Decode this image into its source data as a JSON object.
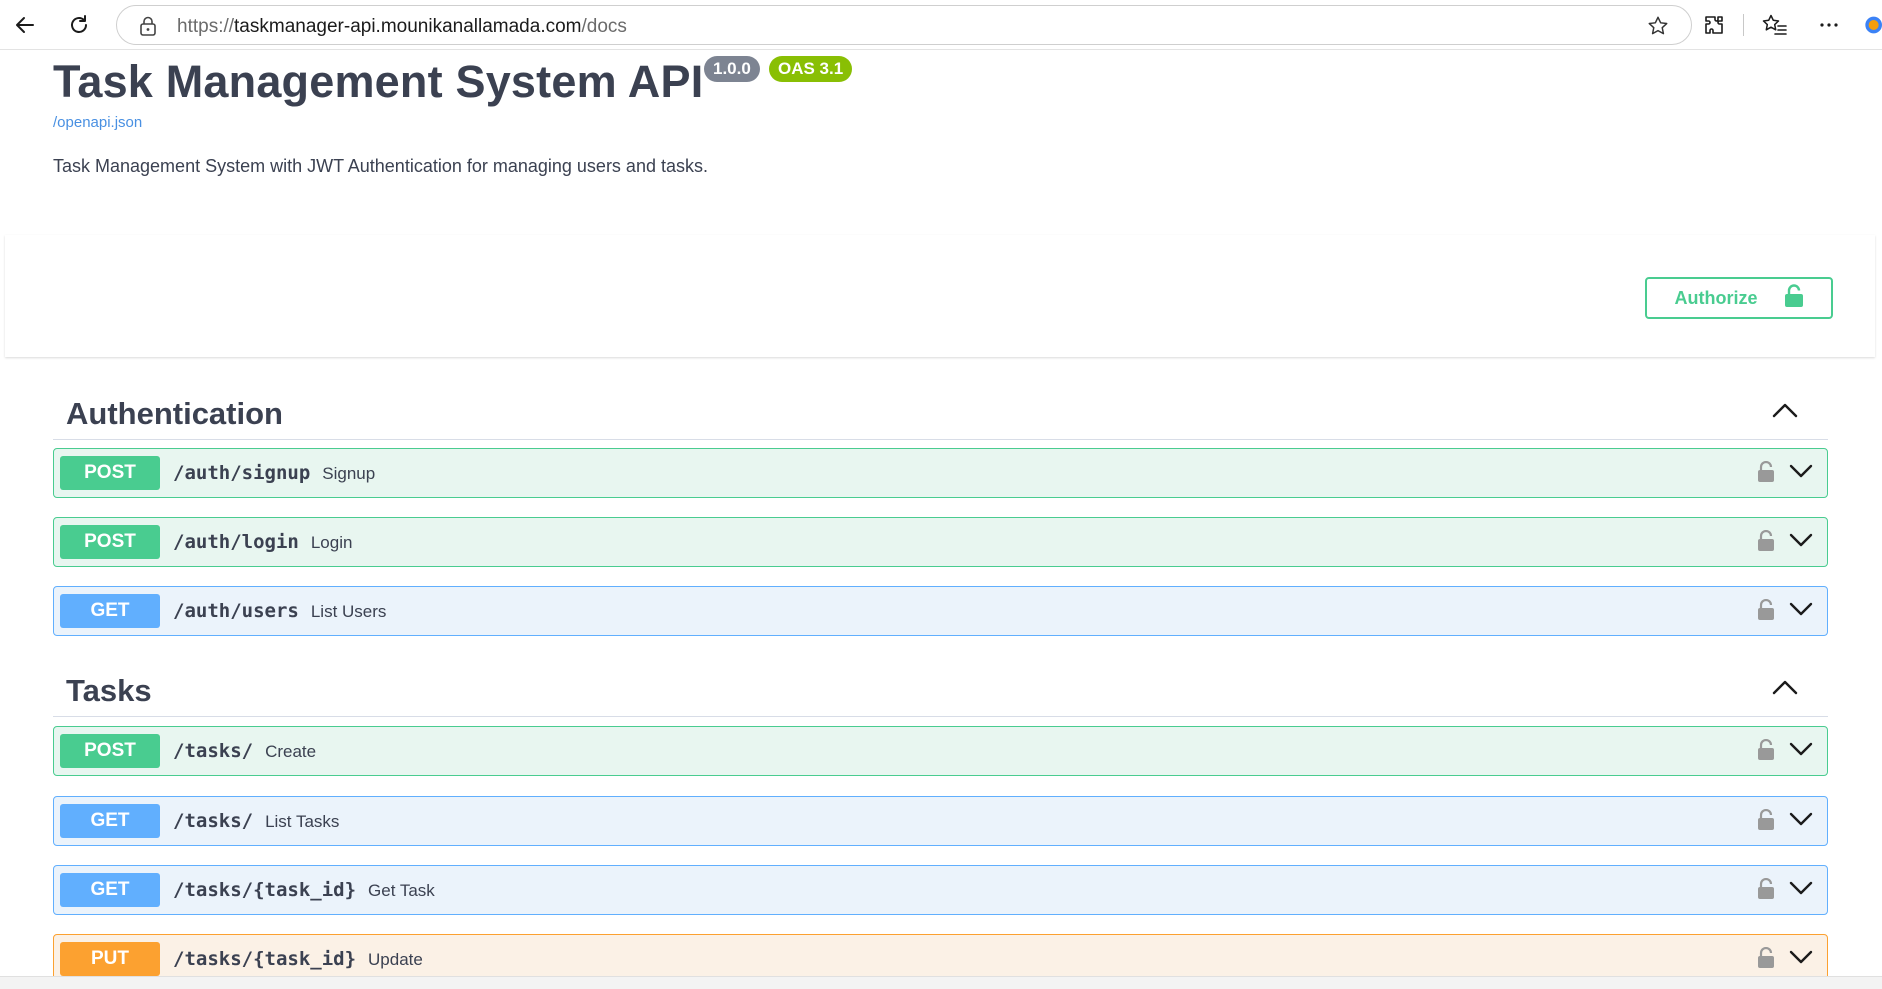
{
  "browser": {
    "url_prefix": "https://",
    "url_host": "taskmanager-api.mounikanallamada.com",
    "url_path": "/docs",
    "icons": [
      "back-arrow-icon",
      "refresh-icon",
      "lock-icon",
      "star-icon",
      "extensions-icon",
      "favorites-icon",
      "more-icon",
      "copilot-icon"
    ]
  },
  "info": {
    "title": "Task Management System API",
    "version_badge": "1.0.0",
    "oas_badge": "OAS 3.1",
    "spec_link": "/openapi.json",
    "description": "Task Management System with JWT Authentication for managing users and tasks."
  },
  "scheme": {
    "authorize_label": "Authorize"
  },
  "tags": [
    {
      "name": "Authentication",
      "operations": [
        {
          "method": "POST",
          "path": "/auth/signup",
          "summary": "Signup"
        },
        {
          "method": "POST",
          "path": "/auth/login",
          "summary": "Login"
        },
        {
          "method": "GET",
          "path": "/auth/users",
          "summary": "List Users"
        }
      ]
    },
    {
      "name": "Tasks",
      "operations": [
        {
          "method": "POST",
          "path": "/tasks/",
          "summary": "Create"
        },
        {
          "method": "GET",
          "path": "/tasks/",
          "summary": "List Tasks"
        },
        {
          "method": "GET",
          "path": "/tasks/{task_id}",
          "summary": "Get Task"
        },
        {
          "method": "PUT",
          "path": "/tasks/{task_id}",
          "summary": "Update"
        }
      ]
    }
  ],
  "colors": {
    "post": "#49cc90",
    "get": "#61affe",
    "put": "#fca130",
    "text": "#3b4151",
    "link": "#4990e2",
    "version_badge": "#7d8492",
    "oas_badge": "#89bf04"
  }
}
